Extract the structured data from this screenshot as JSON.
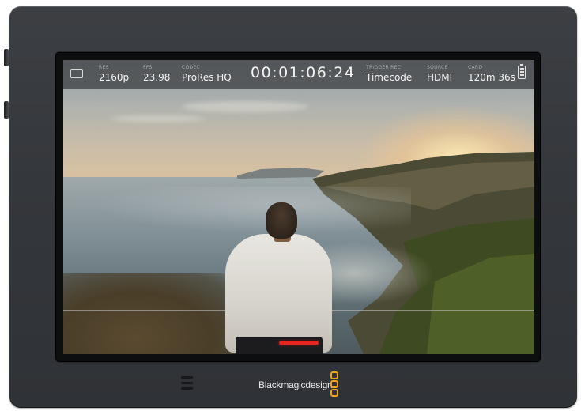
{
  "status_bar": {
    "res": {
      "label": "RES",
      "value": "2160p"
    },
    "fps": {
      "label": "FPS",
      "value": "23.98"
    },
    "codec": {
      "label": "CODEC",
      "value": "ProRes HQ"
    },
    "timecode": "00:01:06:24",
    "trigger_rec": {
      "label": "TRIGGER REC",
      "value": "Timecode"
    },
    "source": {
      "label": "SOURCE",
      "value": "HDMI"
    },
    "card": {
      "label": "CARD",
      "value": "120m 36s"
    }
  },
  "brand": {
    "name": "Blackmagicdesign",
    "logo_color": "#f0a31c"
  },
  "recording_indicator_color": "#e6261f",
  "icons": [
    "frame-guide-icon",
    "battery-icon",
    "menu-icon",
    "brand-logo-icon"
  ]
}
